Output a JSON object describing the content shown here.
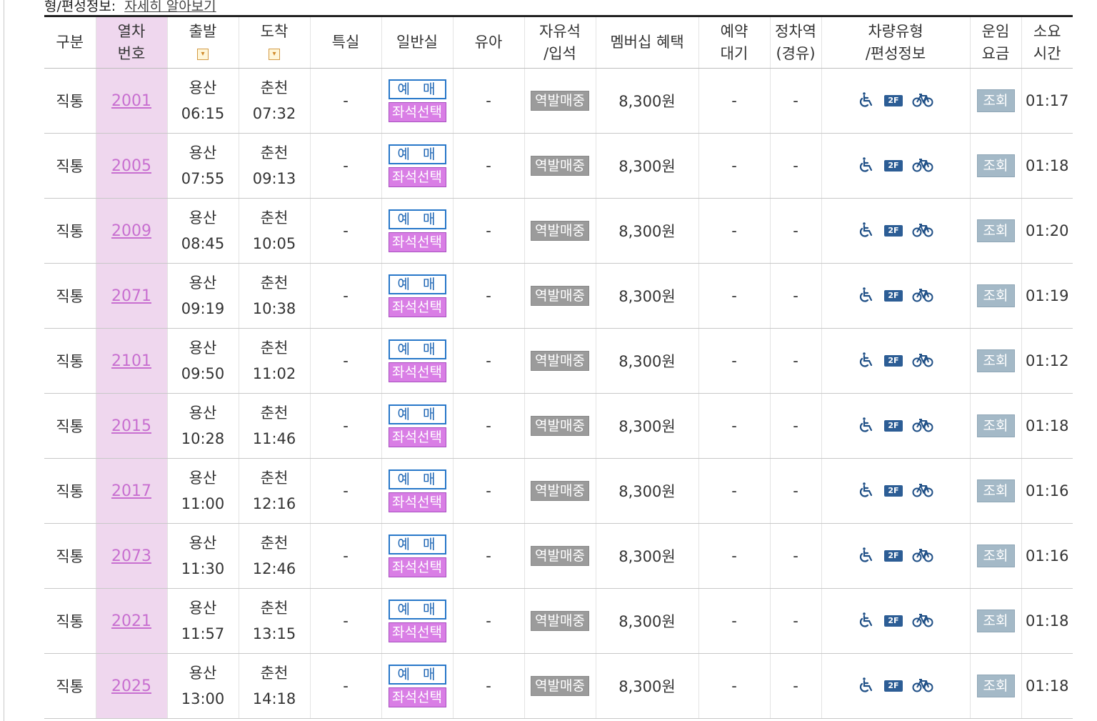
{
  "header": {
    "title_fragment": "형/편성정보:",
    "detail_link": "자세히 알아보기"
  },
  "columns": {
    "type": "구분",
    "train_no": [
      "열차",
      "번호"
    ],
    "departure": "출발",
    "arrival": "도착",
    "special": "특실",
    "general": "일반실",
    "infant": "유아",
    "standing": [
      "자유석",
      "/입석"
    ],
    "membership": "멤버십 혜택",
    "waitlist": [
      "예약",
      "대기"
    ],
    "stop_station": [
      "정차역",
      "(경유)"
    ],
    "vehicle": [
      "차량유형",
      "/편성정보"
    ],
    "fare": [
      "운임",
      "요금"
    ],
    "duration": [
      "소요",
      "시간"
    ]
  },
  "labels": {
    "sort_icon": "▾",
    "reserve": "예 매",
    "seat_select": "좌석선택",
    "station_sale": "역발매중",
    "lookup": "조회",
    "dash": "-",
    "vehicle_icons": [
      "wheelchair-icon",
      "double-deck-2f-icon",
      "bicycle-icon"
    ],
    "two_f": "2F"
  },
  "colors": {
    "reserve_border": "#2777c9",
    "seat_select_bg": "#d97ee5",
    "train_no_highlight": "#efd7ee",
    "lookup_bg": "#a4b9c7",
    "station_sale_bg": "#9b9b9b"
  },
  "rows": [
    {
      "type": "직통",
      "train_no": "2001",
      "dep_station": "용산",
      "dep_time": "06:15",
      "arr_station": "춘천",
      "arr_time": "07:32",
      "benefit": "8,300원",
      "duration": "01:17"
    },
    {
      "type": "직통",
      "train_no": "2005",
      "dep_station": "용산",
      "dep_time": "07:55",
      "arr_station": "춘천",
      "arr_time": "09:13",
      "benefit": "8,300원",
      "duration": "01:18"
    },
    {
      "type": "직통",
      "train_no": "2009",
      "dep_station": "용산",
      "dep_time": "08:45",
      "arr_station": "춘천",
      "arr_time": "10:05",
      "benefit": "8,300원",
      "duration": "01:20"
    },
    {
      "type": "직통",
      "train_no": "2071",
      "dep_station": "용산",
      "dep_time": "09:19",
      "arr_station": "춘천",
      "arr_time": "10:38",
      "benefit": "8,300원",
      "duration": "01:19"
    },
    {
      "type": "직통",
      "train_no": "2101",
      "dep_station": "용산",
      "dep_time": "09:50",
      "arr_station": "춘천",
      "arr_time": "11:02",
      "benefit": "8,300원",
      "duration": "01:12"
    },
    {
      "type": "직통",
      "train_no": "2015",
      "dep_station": "용산",
      "dep_time": "10:28",
      "arr_station": "춘천",
      "arr_time": "11:46",
      "benefit": "8,300원",
      "duration": "01:18"
    },
    {
      "type": "직통",
      "train_no": "2017",
      "dep_station": "용산",
      "dep_time": "11:00",
      "arr_station": "춘천",
      "arr_time": "12:16",
      "benefit": "8,300원",
      "duration": "01:16"
    },
    {
      "type": "직통",
      "train_no": "2073",
      "dep_station": "용산",
      "dep_time": "11:30",
      "arr_station": "춘천",
      "arr_time": "12:46",
      "benefit": "8,300원",
      "duration": "01:16"
    },
    {
      "type": "직통",
      "train_no": "2021",
      "dep_station": "용산",
      "dep_time": "11:57",
      "arr_station": "춘천",
      "arr_time": "13:15",
      "benefit": "8,300원",
      "duration": "01:18"
    },
    {
      "type": "직통",
      "train_no": "2025",
      "dep_station": "용산",
      "dep_time": "13:00",
      "arr_station": "춘천",
      "arr_time": "14:18",
      "benefit": "8,300원",
      "duration": "01:18"
    }
  ]
}
